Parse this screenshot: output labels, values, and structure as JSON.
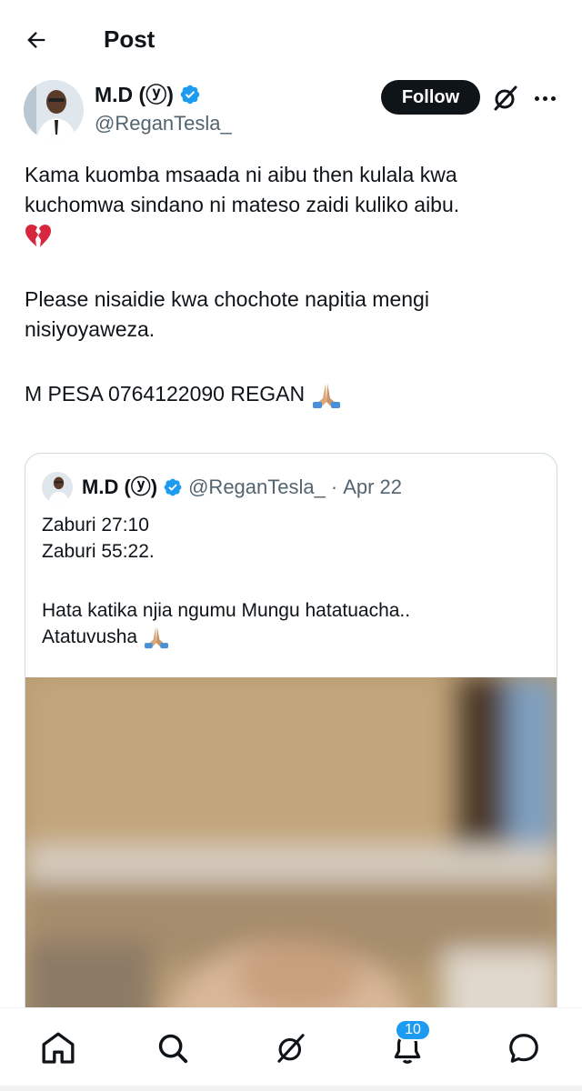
{
  "header": {
    "title": "Post",
    "back_icon": "arrow-left-icon"
  },
  "author": {
    "name": "M.D (ⓨ)",
    "handle": "@ReganTesla_",
    "verified_color": "#1d9bf0",
    "follow_label": "Follow"
  },
  "post": {
    "line1": "Kama kuomba msaada ni aibu then kulala kwa kuchomwa sindano ni mateso zaidi kuliko aibu.",
    "emoji1": "broken-heart-emoji",
    "line2": "Please nisaidie kwa chochote napitia mengi nisiyoyaweza.",
    "line3": "M PESA 0764122090 REGAN",
    "emoji3": "folded-hands-emoji"
  },
  "quote": {
    "name": "M.D (ⓨ)",
    "handle": "@ReganTesla_",
    "separator": "·",
    "date": "Apr 22",
    "line1": "Zaburi 27:10",
    "line2": "Zaburi 55:22.",
    "line3": "Hata katika njia ngumu Mungu hatatuacha..",
    "line4": "Atatuvusha",
    "emoji4": "folded-hands-emoji"
  },
  "bottom_nav": {
    "items": [
      "home-icon",
      "search-icon",
      "grok-icon",
      "notifications-icon",
      "messages-icon"
    ],
    "notification_count": "10"
  },
  "colors": {
    "accent": "#1d9bf0",
    "text": "#0f1419",
    "muted": "#536471",
    "border": "#cfd9de"
  }
}
